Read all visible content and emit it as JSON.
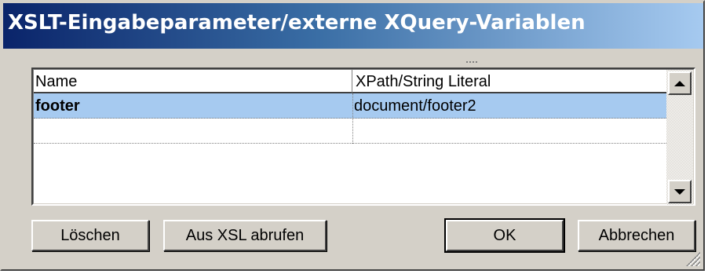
{
  "dialog": {
    "title": "XSLT-Eingabeparameter/externe XQuery-Variablen"
  },
  "table": {
    "columns": [
      "Name",
      "XPath/String Literal"
    ],
    "rows": [
      {
        "name": "footer",
        "value": "document/footer2",
        "selected": true
      },
      {
        "name": "",
        "value": "",
        "selected": false
      }
    ]
  },
  "buttons": {
    "delete": "Löschen",
    "fetch_from_xsl": "Aus XSL abrufen",
    "ok": "OK",
    "cancel": "Abbrechen"
  },
  "icons": {
    "scroll_up": "triangle-up-icon",
    "scroll_down": "triangle-down-icon",
    "resize": "resize-grip-icon"
  },
  "colors": {
    "title_gradient_start": "#0a246a",
    "selection": "#a6caf0",
    "face": "#d4d0c8"
  }
}
